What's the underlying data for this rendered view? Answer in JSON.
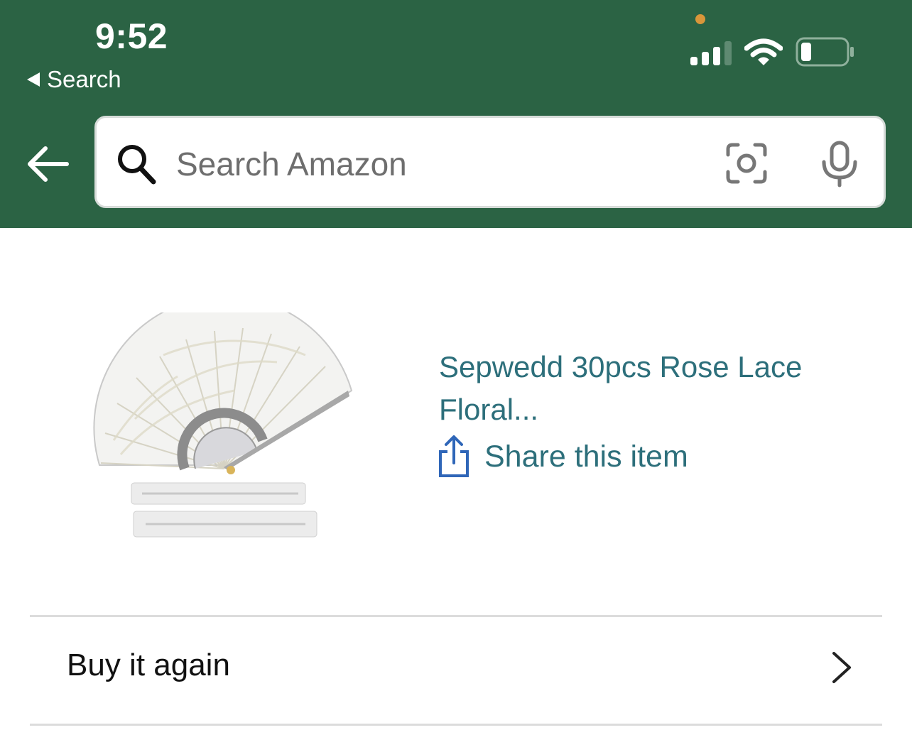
{
  "status_bar": {
    "time": "9:52",
    "back_app_label": "Search",
    "recording_dot_color": "#d9963a",
    "icons": [
      "cellular-signal-icon",
      "wifi-icon",
      "battery-icon"
    ]
  },
  "colors": {
    "header_bg": "#2b6344",
    "link_teal": "#2d6f7b",
    "share_icon_blue": "#2f66b8"
  },
  "search": {
    "placeholder": "Search Amazon",
    "value": "",
    "icons": [
      "search-icon",
      "camera-icon",
      "microphone-icon"
    ]
  },
  "product": {
    "title": "Sepwedd 30pcs Rose Lace Floral...",
    "share_label": "Share this item",
    "image_icon": "lace-hand-fan-product-image"
  },
  "actions": {
    "buy_again_label": "Buy it again"
  }
}
